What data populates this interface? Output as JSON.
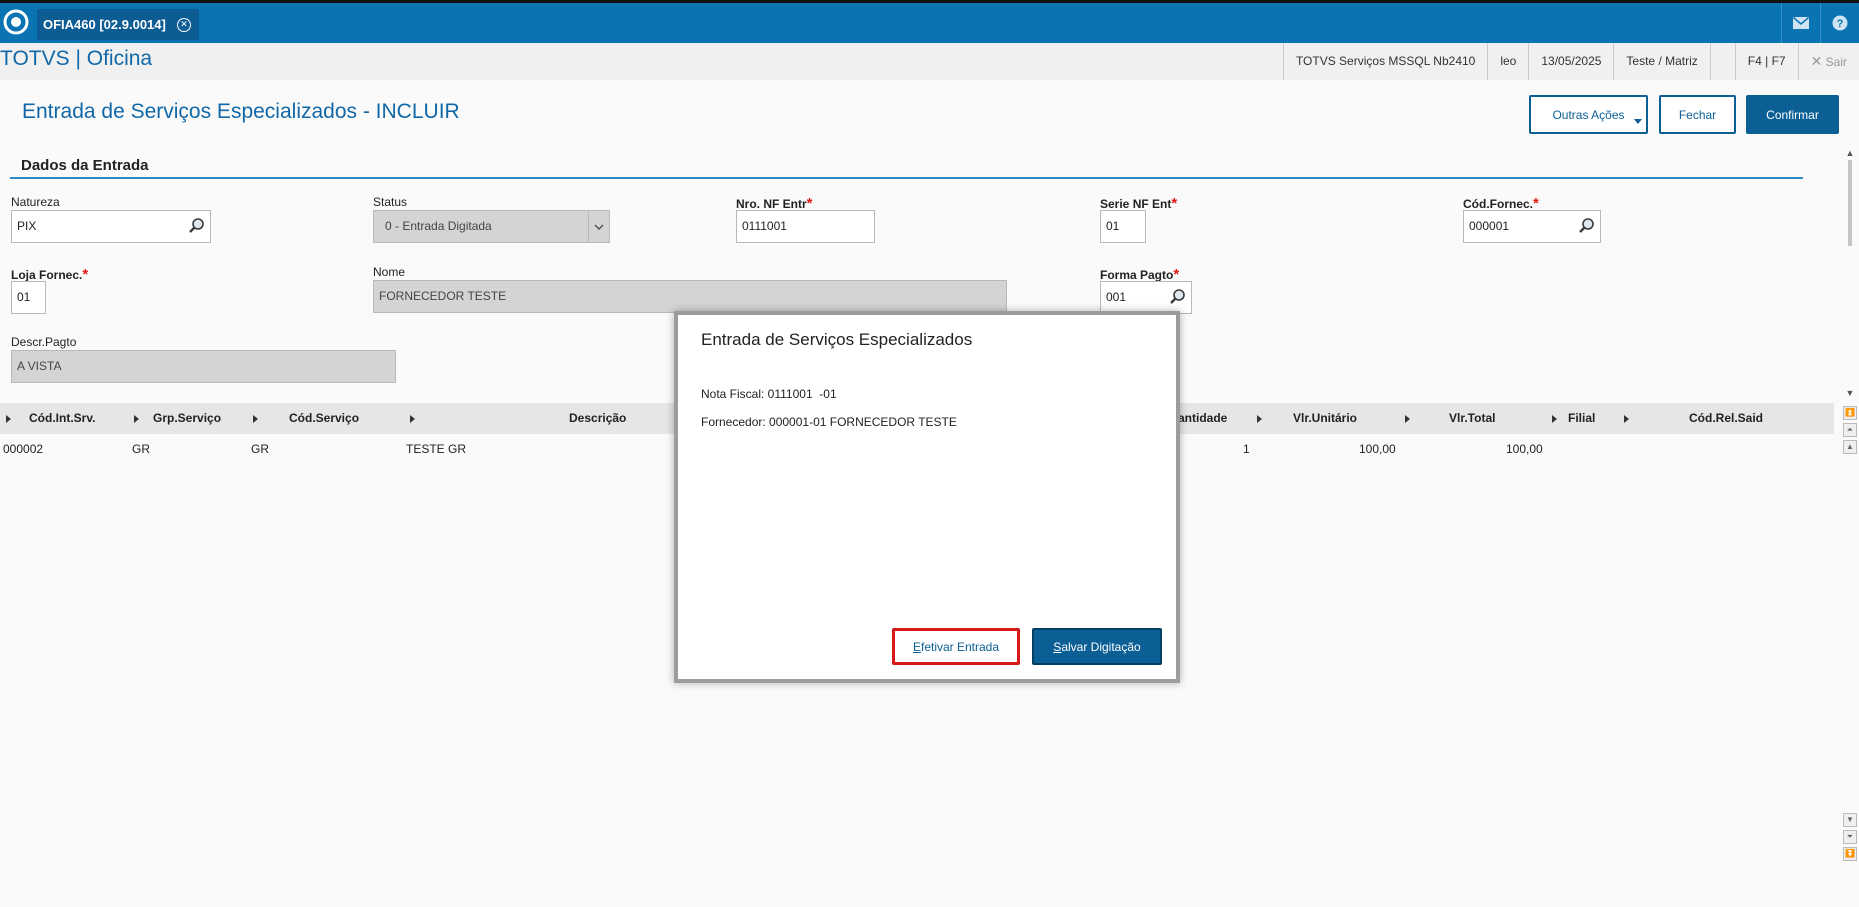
{
  "tab": {
    "label": "OFIA460 [02.9.0014]"
  },
  "brand": "TOTVS | Oficina",
  "env_info": [
    "TOTVS Serviços MSSQL Nb2410",
    "leo",
    "13/05/2025",
    "Teste / Matriz",
    "",
    "F4 | F7"
  ],
  "exit_label": "Sair",
  "page_title": "Entrada de Serviços Especializados - INCLUIR",
  "buttons": {
    "outras": "Outras Ações",
    "fechar": "Fechar",
    "confirmar": "Confirmar"
  },
  "section_title": "Dados da Entrada",
  "fields": {
    "natureza": {
      "label": "Natureza",
      "value": "PIX"
    },
    "status": {
      "label": "Status",
      "value": "0 - Entrada Digitada"
    },
    "nro_nf": {
      "label": "Nro. NF Entr",
      "value": "0111001"
    },
    "serie_nf": {
      "label": "Serie NF Ent",
      "value": "01"
    },
    "cod_fornec": {
      "label": "Cód.Fornec.",
      "value": "000001"
    },
    "loja_fornec": {
      "label": "Loja Fornec.",
      "value": "01"
    },
    "nome": {
      "label": "Nome",
      "value": "FORNECEDOR TESTE"
    },
    "forma_pagto": {
      "label": "Forma Pagto",
      "value": "001"
    },
    "descr_pagto": {
      "label": "Descr.Pagto",
      "value": "A VISTA"
    }
  },
  "grid": {
    "columns": [
      "Cód.Int.Srv.",
      "Grp.Serviço",
      "Cód.Serviço",
      "Descrição",
      "antidade",
      "Vlr.Unitário",
      "Vlr.Total",
      "Filial",
      "Cód.Rel.Said"
    ],
    "rows": [
      {
        "cod_int": "000002",
        "grp": "GR",
        "cod_serv": "GR",
        "descricao": "TESTE GR",
        "quantidade": "1",
        "vlr_unit": "100,00",
        "vlr_total": "100,00"
      }
    ]
  },
  "modal": {
    "title": "Entrada de Serviços Especializados",
    "line1": "Nota Fiscal: 0111001  -01",
    "line2": "Fornecedor: 000001-01 FORNECEDOR TESTE",
    "btn_efetivar_first": "E",
    "btn_efetivar_rest": "fetivar Entrada",
    "btn_salvar_first": "S",
    "btn_salvar_rest": "alvar Digitação"
  },
  "colors": {
    "header_blue": "#0a73b2",
    "primary": "#0b5f95",
    "accent_line": "#2b8bc7",
    "highlight_red": "#d61a1a"
  }
}
